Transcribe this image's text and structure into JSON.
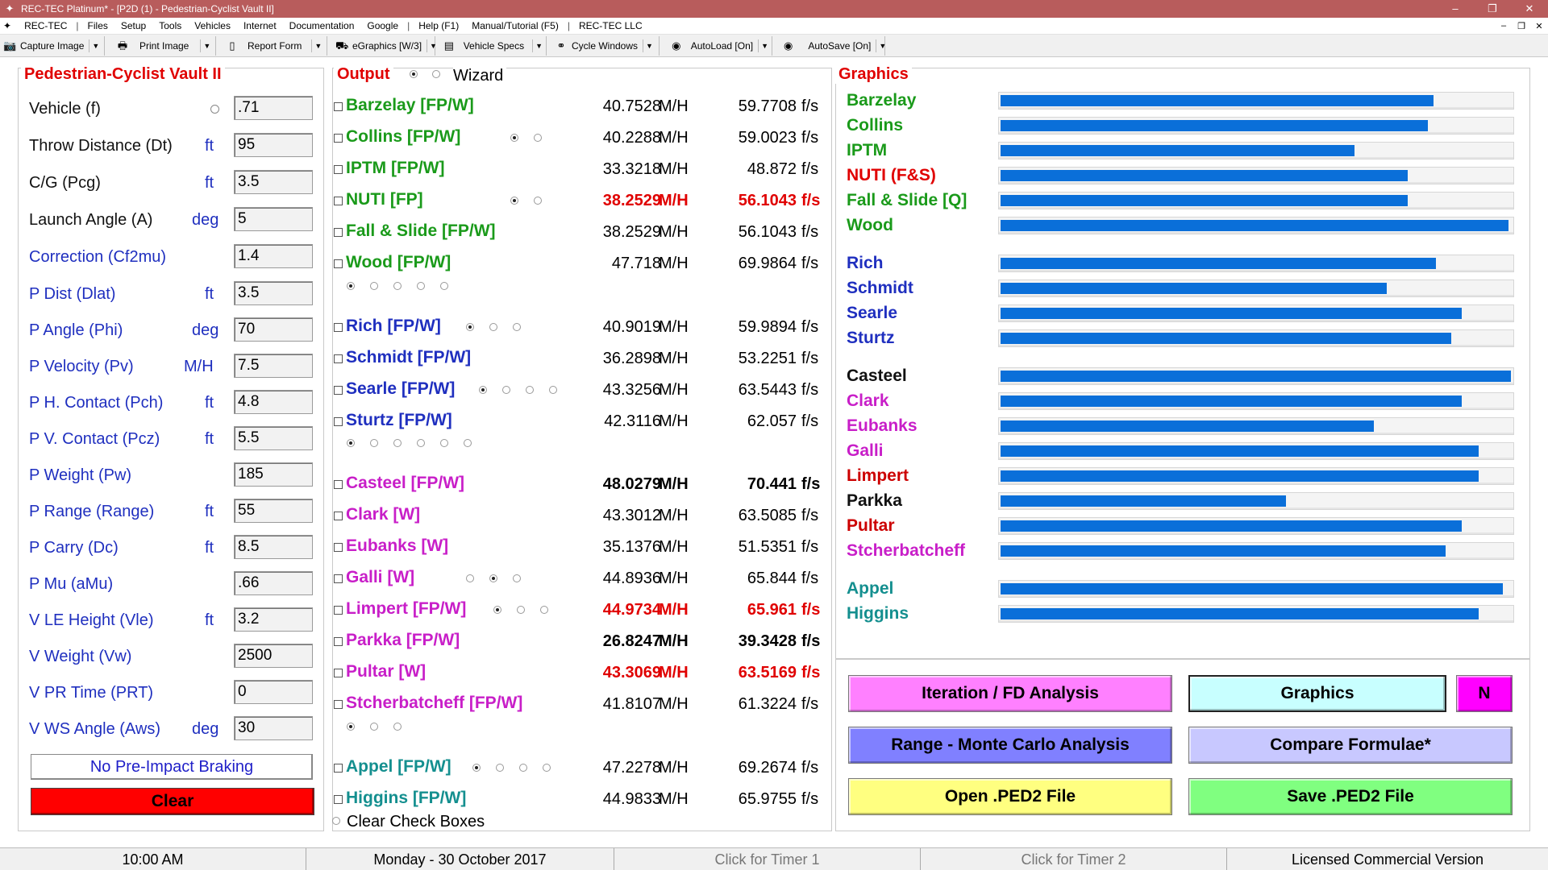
{
  "window": {
    "title": "REC-TEC Platinum* - [P2D  (1) - Pedestrian-Cyclist Vault II]",
    "controls": {
      "minimize": "–",
      "restore": "❐",
      "close": "✕"
    }
  },
  "menu": {
    "items": [
      "REC-TEC",
      "Files",
      "Setup",
      "Tools",
      "Vehicles",
      "Internet",
      "Documentation",
      "Google",
      "Help (F1)",
      "Manual/Tutorial (F5)",
      "REC-TEC LLC"
    ],
    "separator": "|",
    "mdi_controls": {
      "minimize": "–",
      "restore": "❐",
      "close": "✕"
    }
  },
  "toolbar": {
    "items": [
      {
        "label": "Capture Image",
        "icon": "camera-icon"
      },
      {
        "label": "Print Image",
        "icon": "printer-icon"
      },
      {
        "label": "Report Form",
        "icon": "report-icon"
      },
      {
        "label": "eGraphics [W/3]",
        "icon": "egraphics-icon"
      },
      {
        "label": "Vehicle Specs",
        "icon": "vehicle-specs-icon"
      },
      {
        "label": "Cycle Windows",
        "icon": "binoculars-icon"
      },
      {
        "label": "AutoLoad [On]",
        "icon": "autoload-icon"
      },
      {
        "label": "AutoSave [On]",
        "icon": "autosave-icon"
      }
    ],
    "dropdown_glyph": "▼"
  },
  "left": {
    "title": "Pedestrian-Cyclist Vault II",
    "inputs": [
      {
        "label": "Vehicle (f)",
        "unit": "",
        "value": ".71",
        "color": "#111111",
        "radio": true
      },
      {
        "label": "Throw Distance (Dt)",
        "unit": "ft",
        "value": "95",
        "color": "#111111"
      },
      {
        "label": "C/G  (Pcg)",
        "unit": "ft",
        "value": "3.5",
        "color": "#111111"
      },
      {
        "label": "Launch Angle (A)",
        "unit": "deg",
        "value": "5",
        "color": "#111111"
      },
      {
        "label": "Correction (Cf2mu)",
        "unit": "",
        "value": "1.4",
        "color": "#1f2fbf"
      },
      {
        "label": "P Dist (Dlat)",
        "unit": "ft",
        "value": "3.5",
        "color": "#1f2fbf"
      },
      {
        "label": "P Angle (Phi)",
        "unit": "deg",
        "value": "70",
        "color": "#1f2fbf"
      },
      {
        "label": "P Velocity (Pv)",
        "unit": "M/H",
        "value": "7.5",
        "color": "#1f2fbf"
      },
      {
        "label": "P  H. Contact (Pch)",
        "unit": "ft",
        "value": "4.8",
        "color": "#1f2fbf"
      },
      {
        "label": "P  V. Contact (Pcz)",
        "unit": "ft",
        "value": "5.5",
        "color": "#1f2fbf"
      },
      {
        "label": "P Weight (Pw)",
        "unit": "",
        "value": "185",
        "color": "#1f2fbf"
      },
      {
        "label": "P Range (Range)",
        "unit": "ft",
        "value": "55",
        "color": "#1f2fbf"
      },
      {
        "label": "P Carry (Dc)",
        "unit": "ft",
        "value": "8.5",
        "color": "#1f2fbf"
      },
      {
        "label": "P Mu (aMu)",
        "unit": "",
        "value": ".66",
        "color": "#1f2fbf"
      },
      {
        "label": "V LE Height (Vle)",
        "unit": "ft",
        "value": "3.2",
        "color": "#1f2fbf"
      },
      {
        "label": "V Weight (Vw)",
        "unit": "",
        "value": "2500",
        "color": "#1f2fbf"
      },
      {
        "label": "V PR Time (PRT)",
        "unit": "",
        "value": "0",
        "color": "#1f2fbf"
      },
      {
        "label": "V WS Angle (Aws)",
        "unit": "deg",
        "value": "30",
        "color": "#1f2fbf"
      }
    ],
    "braking_label": "No Pre-Impact Braking",
    "clear_label": "Clear"
  },
  "output": {
    "title": "Output",
    "wizard_label": "Wizard",
    "mph_unit": "M/H",
    "fps_unit": "f/s",
    "clear_checkboxes_label": "Clear Check Boxes",
    "results": [
      {
        "name": "Barzelay [FP/W]",
        "mph": "40.7528",
        "fps": "59.7708",
        "color": "#1a9a1a",
        "style": "normal",
        "radios_on": [],
        "radios_total": 0
      },
      {
        "name": "Collins [FP/W]",
        "mph": "40.2288",
        "fps": "59.0023",
        "color": "#1a9a1a",
        "style": "normal",
        "radios_on": [
          0
        ],
        "radios_total": 2
      },
      {
        "name": "IPTM [FP/W]",
        "mph": "33.3218",
        "fps": "48.872",
        "color": "#1a9a1a",
        "style": "normal",
        "radios_on": [],
        "radios_total": 0
      },
      {
        "name": "NUTI [FP]",
        "mph": "38.2529",
        "fps": "56.1043",
        "color": "#1a9a1a",
        "style": "red",
        "radios_on": [
          0
        ],
        "radios_total": 2
      },
      {
        "name": "Fall & Slide [FP/W]",
        "mph": "38.2529",
        "fps": "56.1043",
        "color": "#1a9a1a",
        "style": "normal",
        "radios_on": [],
        "radios_total": 0
      },
      {
        "name": "Wood [FP/W]",
        "mph": "47.718",
        "fps": "69.9864",
        "color": "#1a9a1a",
        "style": "normal",
        "radios_on": [],
        "radios_total": 0,
        "subradios": 5
      },
      {
        "name": "Rich [FP/W]",
        "mph": "40.9019",
        "fps": "59.9894",
        "color": "#1f2fbf",
        "style": "normal",
        "radios_on": [
          0
        ],
        "radios_total": 3
      },
      {
        "name": "Schmidt [FP/W]",
        "mph": "36.2898",
        "fps": "53.2251",
        "color": "#1f2fbf",
        "style": "normal",
        "radios_on": [],
        "radios_total": 0
      },
      {
        "name": "Searle [FP/W]",
        "mph": "43.3256",
        "fps": "63.5443",
        "color": "#1f2fbf",
        "style": "normal",
        "radios_on": [
          0
        ],
        "radios_total": 4
      },
      {
        "name": "Sturtz [FP/W]",
        "mph": "42.3116",
        "fps": "62.057",
        "color": "#1f2fbf",
        "style": "normal",
        "radios_on": [],
        "radios_total": 0,
        "subradios": 6
      },
      {
        "name": "Casteel [FP/W]",
        "mph": "48.0279",
        "fps": "70.441",
        "color": "#c81ec8",
        "style": "black",
        "radios_on": [],
        "radios_total": 0
      },
      {
        "name": "Clark [W]",
        "mph": "43.3012",
        "fps": "63.5085",
        "color": "#c81ec8",
        "style": "normal",
        "radios_on": [],
        "radios_total": 0
      },
      {
        "name": "Eubanks [W]",
        "mph": "35.1376",
        "fps": "51.5351",
        "color": "#c81ec8",
        "style": "normal",
        "radios_on": [],
        "radios_total": 0
      },
      {
        "name": "Galli [W]",
        "mph": "44.8936",
        "fps": "65.844",
        "color": "#c81ec8",
        "style": "normal",
        "radios_on": [
          1
        ],
        "radios_total": 3
      },
      {
        "name": "Limpert [FP/W]",
        "mph": "44.9734",
        "fps": "65.961",
        "color": "#c81ec8",
        "style": "red",
        "radios_on": [
          0
        ],
        "radios_total": 3
      },
      {
        "name": "Parkka [FP/W]",
        "mph": "26.8247",
        "fps": "39.3428",
        "color": "#c81ec8",
        "style": "black",
        "radios_on": [],
        "radios_total": 0
      },
      {
        "name": "Pultar [W]",
        "mph": "43.3069",
        "fps": "63.5169",
        "color": "#c81ec8",
        "style": "red",
        "radios_on": [],
        "radios_total": 0
      },
      {
        "name": "Stcherbatcheff [FP/W]",
        "mph": "41.8107",
        "fps": "61.3224",
        "color": "#c81ec8",
        "style": "normal",
        "radios_on": [],
        "radios_total": 0,
        "subradios": 3
      },
      {
        "name": "Appel [FP/W]",
        "mph": "47.2278",
        "fps": "69.2674",
        "color": "#148f8f",
        "style": "normal",
        "radios_on": [
          0
        ],
        "radios_total": 4
      },
      {
        "name": "Higgins [FP/W]",
        "mph": "44.9833",
        "fps": "65.9755",
        "color": "#148f8f",
        "style": "normal",
        "radios_on": [],
        "radios_total": 0
      }
    ]
  },
  "graphics": {
    "title": "Graphics",
    "bar_color": "#0a6fd9",
    "bars": [
      {
        "name": "Barzelay",
        "level": 0.847,
        "color": "#1a9a1a"
      },
      {
        "name": "Collins",
        "level": 0.836,
        "color": "#1a9a1a"
      },
      {
        "name": "IPTM",
        "level": 0.692,
        "color": "#1a9a1a"
      },
      {
        "name": "NUTI (F&S)",
        "level": 0.796,
        "color": "#e00000"
      },
      {
        "name": "Fall & Slide [Q]",
        "level": 0.796,
        "color": "#1a9a1a"
      },
      {
        "name": "Wood",
        "level": 0.994,
        "color": "#1a9a1a"
      },
      {
        "name": "Rich",
        "level": 0.852,
        "color": "#1f2fbf"
      },
      {
        "name": "Schmidt",
        "level": 0.756,
        "color": "#1f2fbf"
      },
      {
        "name": "Searle",
        "level": 0.902,
        "color": "#1f2fbf"
      },
      {
        "name": "Sturtz",
        "level": 0.881,
        "color": "#1f2fbf"
      },
      {
        "name": "Casteel",
        "level": 0.998,
        "color": "#111111"
      },
      {
        "name": "Clark",
        "level": 0.902,
        "color": "#c81ec8"
      },
      {
        "name": "Eubanks",
        "level": 0.731,
        "color": "#c81ec8"
      },
      {
        "name": "Galli",
        "level": 0.935,
        "color": "#c81ec8"
      },
      {
        "name": "Limpert",
        "level": 0.936,
        "color": "#cc0000"
      },
      {
        "name": "Parkka",
        "level": 0.558,
        "color": "#111111"
      },
      {
        "name": "Pultar",
        "level": 0.902,
        "color": "#cc0000"
      },
      {
        "name": "Stcherbatcheff",
        "level": 0.871,
        "color": "#c81ec8"
      },
      {
        "name": "Appel",
        "level": 0.983,
        "color": "#148f8f"
      },
      {
        "name": "Higgins",
        "level": 0.936,
        "color": "#148f8f"
      }
    ]
  },
  "buttons": {
    "iteration": {
      "label": "Iteration / FD Analysis",
      "color": "#ff80ff"
    },
    "graphics": {
      "label": "Graphics",
      "color": "#c8ffff"
    },
    "n": {
      "label": "N",
      "color": "#ff00ff"
    },
    "range": {
      "label": "Range - Monte Carlo Analysis",
      "color": "#8080ff"
    },
    "compare": {
      "label": "Compare Formulae*",
      "color": "#c8c8ff"
    },
    "open": {
      "label": "Open .PED2 File",
      "color": "#ffff80"
    },
    "save": {
      "label": "Save .PED2 File",
      "color": "#80ff80"
    }
  },
  "status": {
    "time": "10:00 AM",
    "date": "Monday  -  30 October 2017",
    "timer1": "Click for Timer 1",
    "timer2": "Click for Timer 2",
    "license": "Licensed Commercial Version"
  }
}
